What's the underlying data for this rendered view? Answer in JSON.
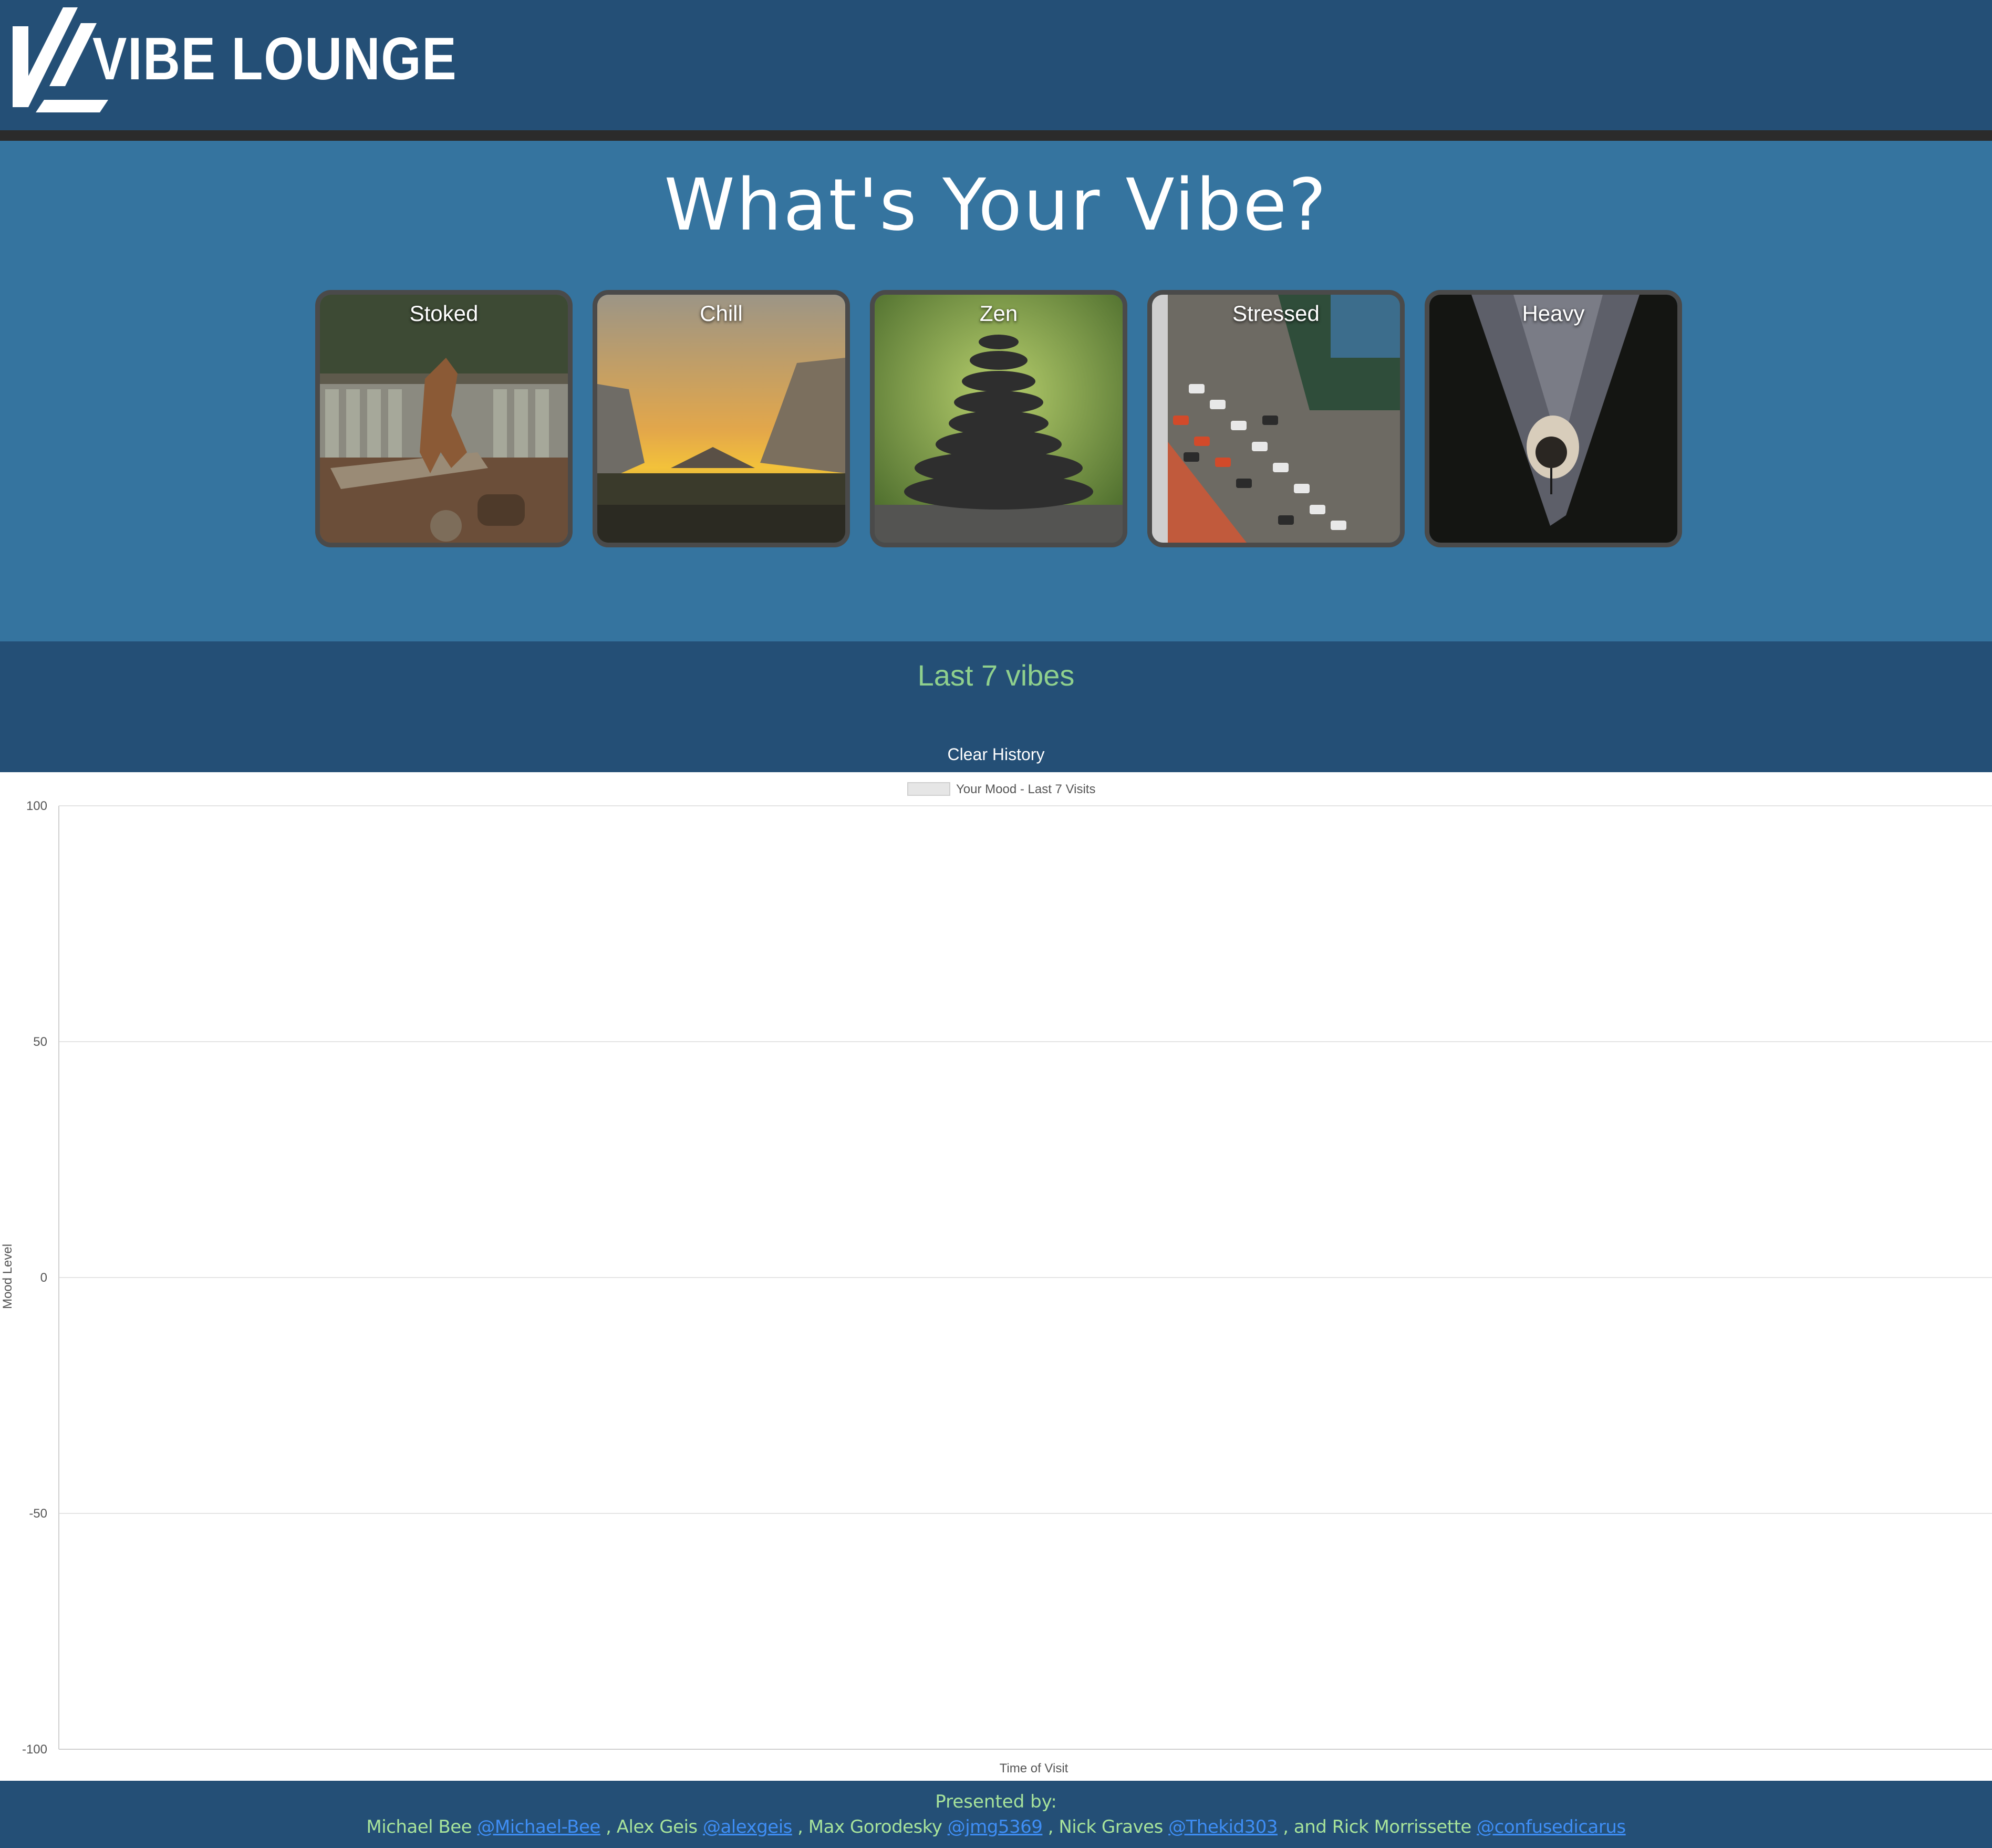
{
  "brand": {
    "logo_text": "VIBE LOUNGE",
    "logo_icon": "vl-logo-icon"
  },
  "hero": {
    "title": "What's Your Vibe?",
    "moods": [
      {
        "label": "Stoked",
        "image": "howling-coyote-photo"
      },
      {
        "label": "Chill",
        "image": "valley-sunset-photo"
      },
      {
        "label": "Zen",
        "image": "stacked-stones-photo"
      },
      {
        "label": "Stressed",
        "image": "traffic-jam-photo"
      },
      {
        "label": "Heavy",
        "image": "hooded-figure-photo"
      }
    ]
  },
  "history": {
    "title": "Last 7 vibes",
    "clear_label": "Clear History"
  },
  "chart_data": {
    "type": "line",
    "title": "",
    "legend": "Your Mood - Last 7 Visits",
    "legend_position": "top",
    "xlabel": "Time of Visit",
    "ylabel": "Mood Level",
    "ylim": [
      -100,
      100
    ],
    "y_ticks": [
      "100",
      "50",
      "0",
      "-50",
      "-100"
    ],
    "grid": true,
    "x": [],
    "series": [
      {
        "name": "Your Mood - Last 7 Visits",
        "values": []
      }
    ]
  },
  "footer": {
    "heading": "Presented by:",
    "credits": [
      {
        "name": "Michael Bee",
        "handle": "@Michael-Bee",
        "sep": " , "
      },
      {
        "name": "Alex Geis",
        "handle": "@alexgeis",
        "sep": " , "
      },
      {
        "name": "Max Gorodesky",
        "handle": "@jmg5369",
        "sep": " , "
      },
      {
        "name": "Nick Graves",
        "handle": "@Thekid303",
        "sep": " , and "
      },
      {
        "name": "Rick Morrissette",
        "handle": "@confusedicarus",
        "sep": ""
      }
    ]
  },
  "colors": {
    "header_bg": "#244f76",
    "hero_bg": "#35749f",
    "history_title": "#8fd08d",
    "footer_text": "#a7e39b",
    "link": "#3f8ef5"
  }
}
